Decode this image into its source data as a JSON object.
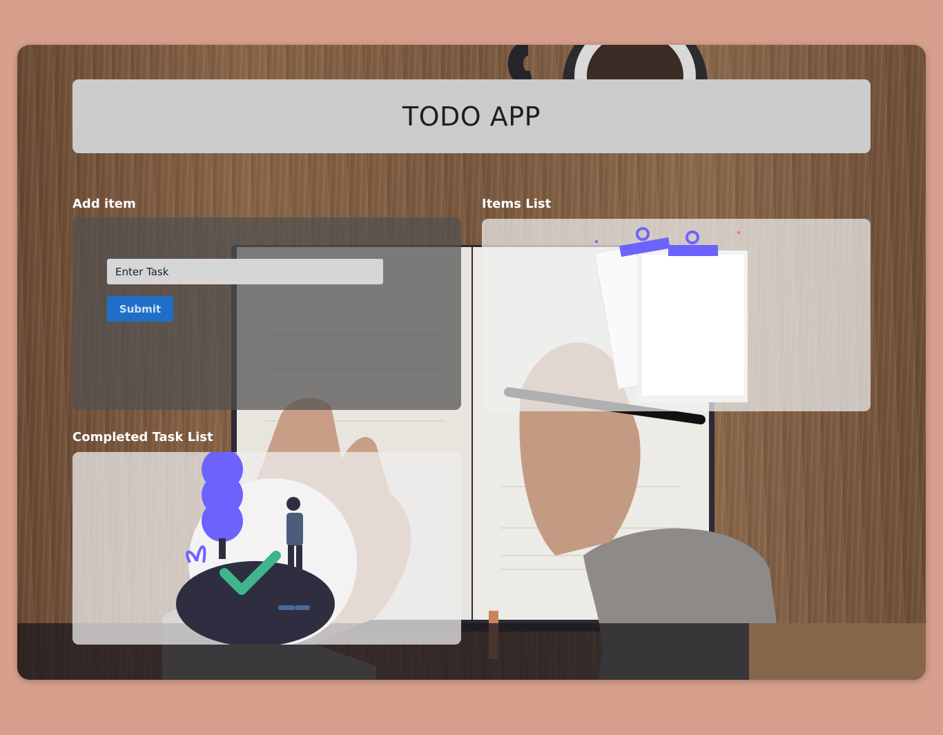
{
  "header": {
    "title": "TODO APP"
  },
  "add_item": {
    "label": "Add item",
    "input_placeholder": "Enter Task",
    "submit_label": "Submit"
  },
  "items_list": {
    "label": "Items List"
  },
  "completed_list": {
    "label": "Completed Task List"
  },
  "colors": {
    "page_bg": "#d8a08c",
    "header_bg": "#cccccc",
    "submit_bg": "#1f6fc8",
    "illustration_accent": "#6c63ff",
    "check_green": "#3fb58b",
    "ground_dark": "#2f2e41"
  }
}
